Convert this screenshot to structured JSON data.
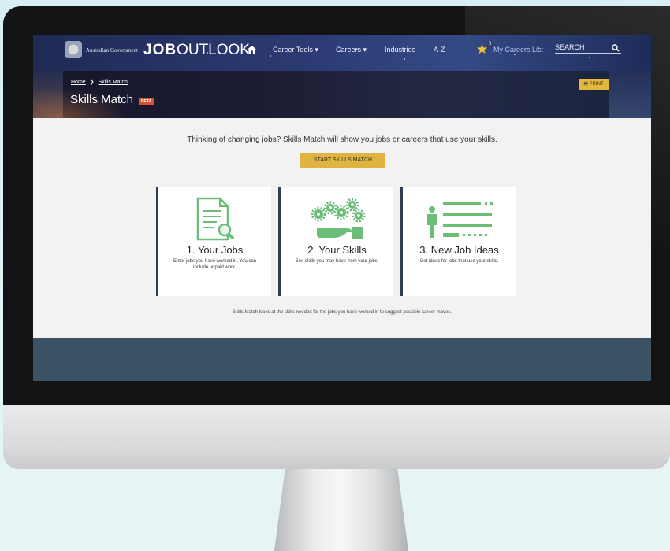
{
  "header": {
    "government_label": "Australian Government",
    "logo_job": "JOB",
    "logo_outlook": "OUTLOOK",
    "nav_items": [
      "Career Tools ▾",
      "Careers ▾",
      "Industries",
      "A-Z"
    ],
    "careers_list_count": "0",
    "careers_list_label": "My Careers List",
    "search_placeholder": "SEARCH"
  },
  "hero": {
    "breadcrumb_home": "Home",
    "breadcrumb_sep": "❯",
    "breadcrumb_current": "Skills Match",
    "title": "Skills Match",
    "badge": "BETA",
    "print_label": "🖶 PRINT"
  },
  "main": {
    "lead": "Thinking of changing jobs? Skills Match will show you jobs or careers that use your skills.",
    "start_label": "START SKILLS MATCH",
    "cards": [
      {
        "title": "1. Your Jobs",
        "desc": "Enter jobs you have worked in. You can include unpaid work."
      },
      {
        "title": "2. Your Skills",
        "desc": "See skills you may have from your jobs."
      },
      {
        "title": "3. New Job Ideas",
        "desc": "Get ideas for jobs that use your skills."
      }
    ],
    "footnote": "Skills Match looks at the skills needed for the jobs you have worked in to suggest possible career moves."
  },
  "colors": {
    "accent_yellow": "#e0b441",
    "icon_green": "#6bbd78",
    "beta_orange": "#d9512c",
    "card_border": "#2f3e52"
  },
  "icons": [
    "home-icon",
    "star-icon",
    "search-icon",
    "document-magnifier-icon",
    "gears-hand-icon",
    "person-list-icon"
  ]
}
